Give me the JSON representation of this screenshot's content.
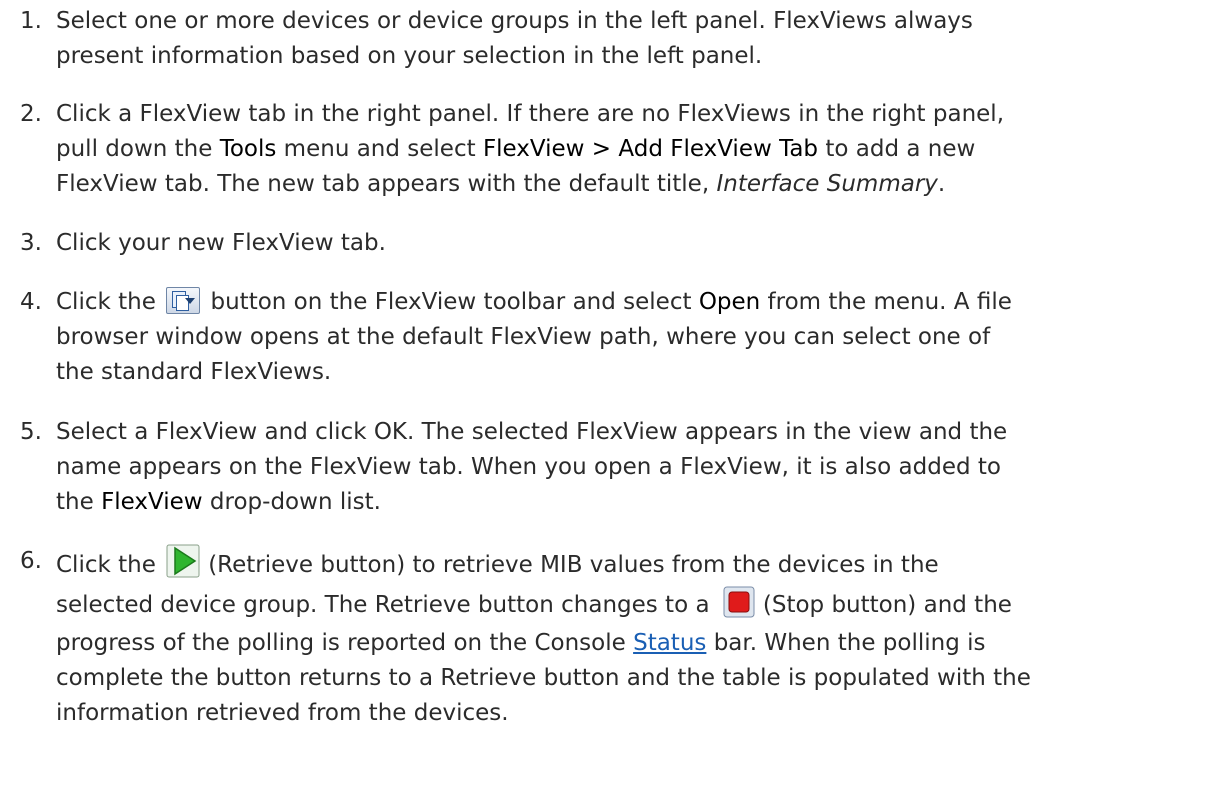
{
  "steps": [
    {
      "num": "1.",
      "lines": [
        [
          "Select one or more devices or device groups in the left panel. FlexViews always"
        ],
        [
          "present information based on your selection in the left panel."
        ]
      ]
    },
    {
      "num": "2.",
      "l1": "Click a FlexView tab in the right panel. If there are no FlexViews in the right panel,",
      "l2a": "pull down the ",
      "l2b": "Tools",
      "l2c": " menu and select ",
      "l2d": "FlexView > Add FlexView Tab",
      "l2e": " to add a new",
      "l3a": "FlexView tab. The new tab appears with the default title, ",
      "l3b": "Interface Summary",
      "l3c": "."
    },
    {
      "num": "3.",
      "l1": "Click your new FlexView tab."
    },
    {
      "num": "4.",
      "l1a": "Click the ",
      "l1b": " button on the FlexView toolbar and select ",
      "l1c": "Open",
      "l1d": " from the menu. A file",
      "l2": "browser window opens at the default FlexView path, where you can select one of",
      "l3": "the standard FlexViews."
    },
    {
      "num": "5.",
      "l1": "Select a FlexView and click OK. The selected FlexView appears in the view and the",
      "l2": "name appears on the FlexView tab. When you open a FlexView, it is also added to",
      "l3a": "the ",
      "l3b": "FlexView",
      "l3c": " drop-down list."
    },
    {
      "num": "6.",
      "l1a": "Click the ",
      "l1b": "(Retrieve button) to retrieve MIB values from the devices in the",
      "l2a": "selected device group. The Retrieve button changes to a ",
      "l2b": "(Stop button) and the",
      "l3a": "progress of the polling is reported on the Console ",
      "l3b": "Status",
      "l3c": " bar. When the polling is",
      "l4": "complete the button returns to a Retrieve button and the table is populated with the",
      "l5": "information retrieved from the devices."
    }
  ],
  "icons": {
    "toolbar_button": "flexview-open-menu-icon",
    "retrieve": "play-icon",
    "stop": "stop-icon"
  },
  "colors": {
    "text": "#2b2b2b",
    "link": "#1a5fb4",
    "retrieve_green": "#2fb52f",
    "stop_red": "#e01b1b"
  }
}
